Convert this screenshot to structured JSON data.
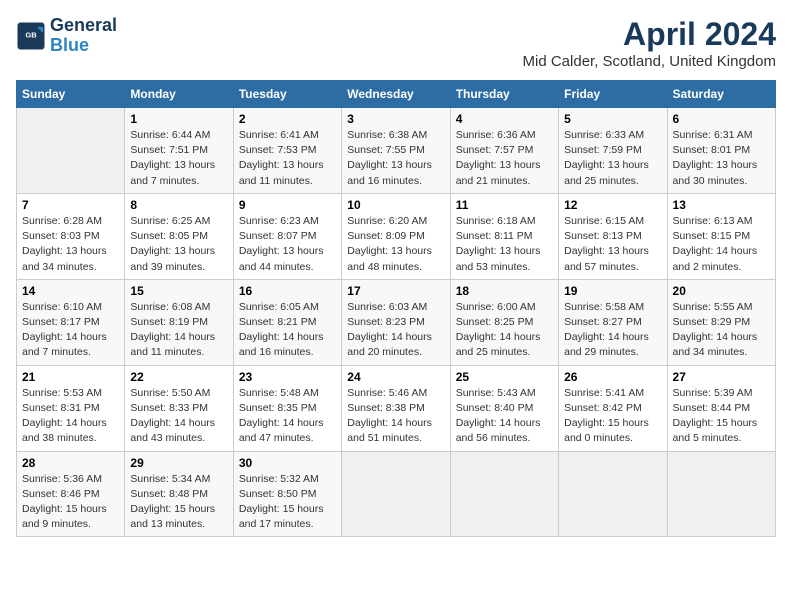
{
  "header": {
    "logo_line1": "General",
    "logo_line2": "Blue",
    "title": "April 2024",
    "subtitle": "Mid Calder, Scotland, United Kingdom"
  },
  "weekdays": [
    "Sunday",
    "Monday",
    "Tuesday",
    "Wednesday",
    "Thursday",
    "Friday",
    "Saturday"
  ],
  "weeks": [
    [
      {
        "day": "",
        "sunrise": "",
        "sunset": "",
        "daylight": "",
        "empty": true
      },
      {
        "day": "1",
        "sunrise": "Sunrise: 6:44 AM",
        "sunset": "Sunset: 7:51 PM",
        "daylight": "Daylight: 13 hours and 7 minutes."
      },
      {
        "day": "2",
        "sunrise": "Sunrise: 6:41 AM",
        "sunset": "Sunset: 7:53 PM",
        "daylight": "Daylight: 13 hours and 11 minutes."
      },
      {
        "day": "3",
        "sunrise": "Sunrise: 6:38 AM",
        "sunset": "Sunset: 7:55 PM",
        "daylight": "Daylight: 13 hours and 16 minutes."
      },
      {
        "day": "4",
        "sunrise": "Sunrise: 6:36 AM",
        "sunset": "Sunset: 7:57 PM",
        "daylight": "Daylight: 13 hours and 21 minutes."
      },
      {
        "day": "5",
        "sunrise": "Sunrise: 6:33 AM",
        "sunset": "Sunset: 7:59 PM",
        "daylight": "Daylight: 13 hours and 25 minutes."
      },
      {
        "day": "6",
        "sunrise": "Sunrise: 6:31 AM",
        "sunset": "Sunset: 8:01 PM",
        "daylight": "Daylight: 13 hours and 30 minutes."
      }
    ],
    [
      {
        "day": "7",
        "sunrise": "Sunrise: 6:28 AM",
        "sunset": "Sunset: 8:03 PM",
        "daylight": "Daylight: 13 hours and 34 minutes."
      },
      {
        "day": "8",
        "sunrise": "Sunrise: 6:25 AM",
        "sunset": "Sunset: 8:05 PM",
        "daylight": "Daylight: 13 hours and 39 minutes."
      },
      {
        "day": "9",
        "sunrise": "Sunrise: 6:23 AM",
        "sunset": "Sunset: 8:07 PM",
        "daylight": "Daylight: 13 hours and 44 minutes."
      },
      {
        "day": "10",
        "sunrise": "Sunrise: 6:20 AM",
        "sunset": "Sunset: 8:09 PM",
        "daylight": "Daylight: 13 hours and 48 minutes."
      },
      {
        "day": "11",
        "sunrise": "Sunrise: 6:18 AM",
        "sunset": "Sunset: 8:11 PM",
        "daylight": "Daylight: 13 hours and 53 minutes."
      },
      {
        "day": "12",
        "sunrise": "Sunrise: 6:15 AM",
        "sunset": "Sunset: 8:13 PM",
        "daylight": "Daylight: 13 hours and 57 minutes."
      },
      {
        "day": "13",
        "sunrise": "Sunrise: 6:13 AM",
        "sunset": "Sunset: 8:15 PM",
        "daylight": "Daylight: 14 hours and 2 minutes."
      }
    ],
    [
      {
        "day": "14",
        "sunrise": "Sunrise: 6:10 AM",
        "sunset": "Sunset: 8:17 PM",
        "daylight": "Daylight: 14 hours and 7 minutes."
      },
      {
        "day": "15",
        "sunrise": "Sunrise: 6:08 AM",
        "sunset": "Sunset: 8:19 PM",
        "daylight": "Daylight: 14 hours and 11 minutes."
      },
      {
        "day": "16",
        "sunrise": "Sunrise: 6:05 AM",
        "sunset": "Sunset: 8:21 PM",
        "daylight": "Daylight: 14 hours and 16 minutes."
      },
      {
        "day": "17",
        "sunrise": "Sunrise: 6:03 AM",
        "sunset": "Sunset: 8:23 PM",
        "daylight": "Daylight: 14 hours and 20 minutes."
      },
      {
        "day": "18",
        "sunrise": "Sunrise: 6:00 AM",
        "sunset": "Sunset: 8:25 PM",
        "daylight": "Daylight: 14 hours and 25 minutes."
      },
      {
        "day": "19",
        "sunrise": "Sunrise: 5:58 AM",
        "sunset": "Sunset: 8:27 PM",
        "daylight": "Daylight: 14 hours and 29 minutes."
      },
      {
        "day": "20",
        "sunrise": "Sunrise: 5:55 AM",
        "sunset": "Sunset: 8:29 PM",
        "daylight": "Daylight: 14 hours and 34 minutes."
      }
    ],
    [
      {
        "day": "21",
        "sunrise": "Sunrise: 5:53 AM",
        "sunset": "Sunset: 8:31 PM",
        "daylight": "Daylight: 14 hours and 38 minutes."
      },
      {
        "day": "22",
        "sunrise": "Sunrise: 5:50 AM",
        "sunset": "Sunset: 8:33 PM",
        "daylight": "Daylight: 14 hours and 43 minutes."
      },
      {
        "day": "23",
        "sunrise": "Sunrise: 5:48 AM",
        "sunset": "Sunset: 8:35 PM",
        "daylight": "Daylight: 14 hours and 47 minutes."
      },
      {
        "day": "24",
        "sunrise": "Sunrise: 5:46 AM",
        "sunset": "Sunset: 8:38 PM",
        "daylight": "Daylight: 14 hours and 51 minutes."
      },
      {
        "day": "25",
        "sunrise": "Sunrise: 5:43 AM",
        "sunset": "Sunset: 8:40 PM",
        "daylight": "Daylight: 14 hours and 56 minutes."
      },
      {
        "day": "26",
        "sunrise": "Sunrise: 5:41 AM",
        "sunset": "Sunset: 8:42 PM",
        "daylight": "Daylight: 15 hours and 0 minutes."
      },
      {
        "day": "27",
        "sunrise": "Sunrise: 5:39 AM",
        "sunset": "Sunset: 8:44 PM",
        "daylight": "Daylight: 15 hours and 5 minutes."
      }
    ],
    [
      {
        "day": "28",
        "sunrise": "Sunrise: 5:36 AM",
        "sunset": "Sunset: 8:46 PM",
        "daylight": "Daylight: 15 hours and 9 minutes."
      },
      {
        "day": "29",
        "sunrise": "Sunrise: 5:34 AM",
        "sunset": "Sunset: 8:48 PM",
        "daylight": "Daylight: 15 hours and 13 minutes."
      },
      {
        "day": "30",
        "sunrise": "Sunrise: 5:32 AM",
        "sunset": "Sunset: 8:50 PM",
        "daylight": "Daylight: 15 hours and 17 minutes."
      },
      {
        "day": "",
        "sunrise": "",
        "sunset": "",
        "daylight": "",
        "empty": true
      },
      {
        "day": "",
        "sunrise": "",
        "sunset": "",
        "daylight": "",
        "empty": true
      },
      {
        "day": "",
        "sunrise": "",
        "sunset": "",
        "daylight": "",
        "empty": true
      },
      {
        "day": "",
        "sunrise": "",
        "sunset": "",
        "daylight": "",
        "empty": true
      }
    ]
  ]
}
